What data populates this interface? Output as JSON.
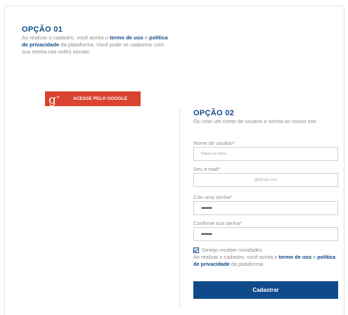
{
  "option1": {
    "title": "OPÇÃO 01",
    "text_before": "Ao realizar o cadastro, você aceita o ",
    "terms_link": "termo de uso",
    "text_mid": " e ",
    "privacy_link": "política de privacidade",
    "text_after": " da plataforma. Você pode se cadastrar com sua senha nas redes sociais:"
  },
  "google_button": {
    "icon_text": "g",
    "icon_sup": "+",
    "label": "ACESSE PELO GOOGLE"
  },
  "option2": {
    "title": "OPÇÃO 02",
    "subtitle": "Ou criar um nome de usuário e senha no nosso site:"
  },
  "form": {
    "username_label": "Nome de usuário*",
    "username_placeholder": "Maria da Silva",
    "email_label": "Seu e-mail*",
    "email_placeholder": "@gmail.com",
    "password_label": "Crie uma senha*",
    "password_value": "•••••••",
    "confirm_label": "Confirme sua senha*",
    "confirm_value": "•••••••",
    "newsletter_label": "Desejo receber novidades",
    "newsletter_checked": true,
    "terms_before": "Ao realizar o cadastro, você aceita o ",
    "terms_link": "termo de uso",
    "terms_mid": " e ",
    "privacy_link": "política de privacidade",
    "terms_after": " da plataforma.",
    "submit_label": "Cadastrar"
  },
  "colors": {
    "brand_blue": "#0f4a8a",
    "google_red": "#d9432f"
  }
}
